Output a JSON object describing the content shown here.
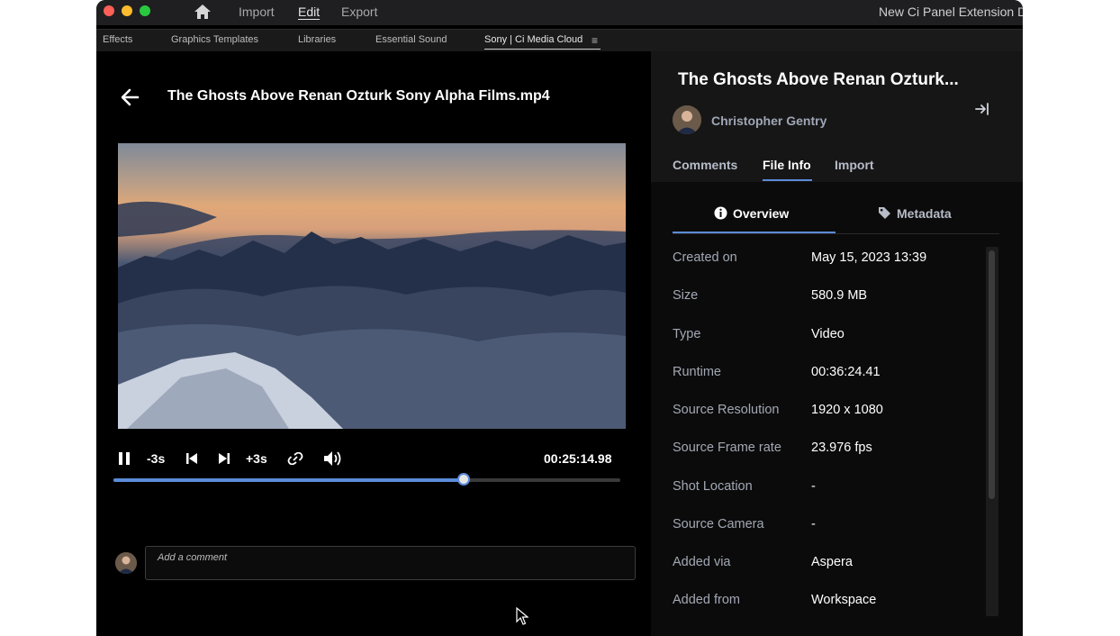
{
  "window": {
    "title": "New Ci Panel Extension De",
    "menu": [
      "Import",
      "Edit",
      "Export"
    ],
    "active_menu": "Edit"
  },
  "panel_tabs": {
    "items": [
      "Effects",
      "Graphics Templates",
      "Libraries",
      "Essential Sound",
      "Sony | Ci Media Cloud"
    ],
    "active": "Sony | Ci Media Cloud"
  },
  "player": {
    "title": "The Ghosts Above Renan Ozturk Sony Alpha Films.mp4",
    "controls": {
      "rewind": "-3s",
      "forward": "+3s"
    },
    "timecode": "00:25:14.98",
    "progress": 0.69,
    "comment_placeholder": "Add a comment"
  },
  "details": {
    "title": "The Ghosts Above Renan Ozturk...",
    "owner": "Christopher Gentry",
    "tabs": [
      "Comments",
      "File Info",
      "Import"
    ],
    "active_tab": "File Info",
    "subtabs": [
      "Overview",
      "Metadata"
    ],
    "active_subtab": "Overview",
    "info": [
      {
        "label": "Created on",
        "value": "May 15, 2023 13:39"
      },
      {
        "label": "Size",
        "value": "580.9 MB"
      },
      {
        "label": "Type",
        "value": "Video"
      },
      {
        "label": "Runtime",
        "value": "00:36:24.41"
      },
      {
        "label": "Source Resolution",
        "value": "1920 x 1080"
      },
      {
        "label": "Source Frame rate",
        "value": "23.976 fps"
      },
      {
        "label": "Shot Location",
        "value": "-"
      },
      {
        "label": "Source Camera",
        "value": "-"
      },
      {
        "label": "Added via",
        "value": "Aspera"
      },
      {
        "label": "Added from",
        "value": "Workspace"
      }
    ]
  },
  "colors": {
    "accent": "#5b8bd9",
    "background": "#000000"
  }
}
